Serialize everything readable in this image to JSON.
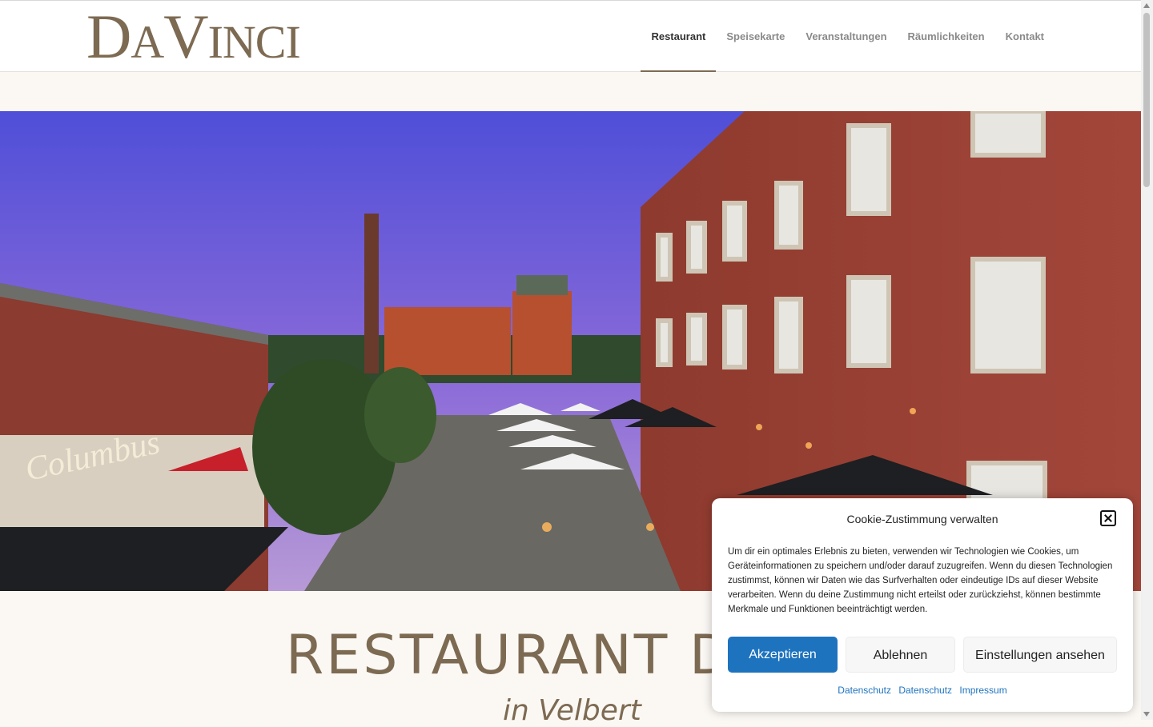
{
  "logo": {
    "big1": "D",
    "small1": "A",
    "big2": "V",
    "small2": "INCI"
  },
  "nav": {
    "items": [
      "Restaurant",
      "Speisekarte",
      "Veranstaltungen",
      "Räumlichkeiten",
      "Kontakt"
    ],
    "active": "Restaurant"
  },
  "hero": {
    "sign": "Columbus"
  },
  "main": {
    "headline": "RESTAURANT DA",
    "subline": "in Velbert"
  },
  "cookie": {
    "title": "Cookie-Zustimmung verwalten",
    "text": "Um dir ein optimales Erlebnis zu bieten, verwenden wir Technologien wie Cookies, um Geräteinformationen zu speichern und/oder darauf zuzugreifen. Wenn du diesen Technologien zustimmst, können wir Daten wie das Surfverhalten oder eindeutige IDs auf dieser Website verarbeiten. Wenn du deine Zustimmung nicht erteilst oder zurückziehst, können bestimmte Merkmale und Funktionen beeinträchtigt werden.",
    "accept": "Akzeptieren",
    "deny": "Ablehnen",
    "settings": "Einstellungen ansehen",
    "links": [
      "Datenschutz",
      "Datenschutz",
      "Impressum"
    ]
  },
  "colors": {
    "brand": "#7d6a52",
    "accent": "#1e73be"
  }
}
